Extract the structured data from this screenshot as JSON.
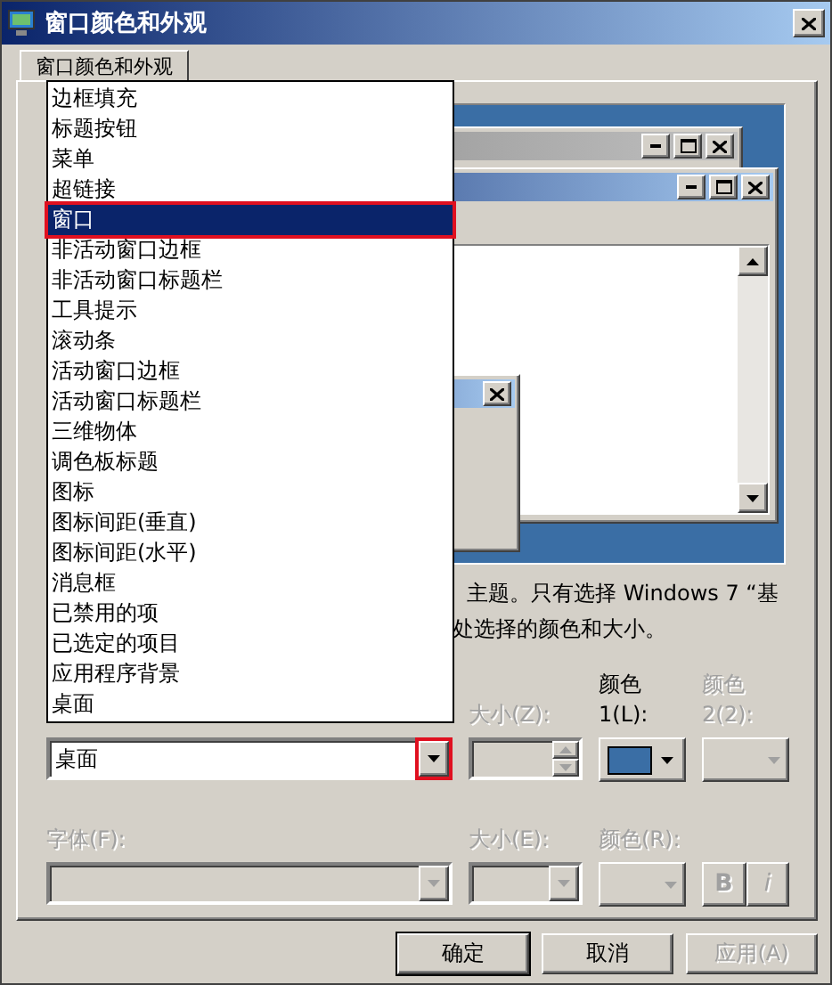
{
  "window": {
    "title": "窗口颜色和外观"
  },
  "tabs": [
    {
      "label": "窗口颜色和外观",
      "selected": true
    }
  ],
  "description": [
    "主题。只有选择 Windows 7 “基",
    "处选择的颜色和大小。"
  ],
  "item_list": {
    "options": [
      {
        "label": "边框填充",
        "selected": false,
        "highlighted": false
      },
      {
        "label": "标题按钮",
        "selected": false,
        "highlighted": false
      },
      {
        "label": "菜单",
        "selected": false,
        "highlighted": false
      },
      {
        "label": "超链接",
        "selected": false,
        "highlighted": false
      },
      {
        "label": "窗口",
        "selected": true,
        "highlighted": true
      },
      {
        "label": "非活动窗口边框",
        "selected": false,
        "highlighted": false
      },
      {
        "label": "非活动窗口标题栏",
        "selected": false,
        "highlighted": false
      },
      {
        "label": "工具提示",
        "selected": false,
        "highlighted": false
      },
      {
        "label": "滚动条",
        "selected": false,
        "highlighted": false
      },
      {
        "label": "活动窗口边框",
        "selected": false,
        "highlighted": false
      },
      {
        "label": "活动窗口标题栏",
        "selected": false,
        "highlighted": false
      },
      {
        "label": "三维物体",
        "selected": false,
        "highlighted": false
      },
      {
        "label": "调色板标题",
        "selected": false,
        "highlighted": false
      },
      {
        "label": "图标",
        "selected": false,
        "highlighted": false
      },
      {
        "label": "图标间距(垂直)",
        "selected": false,
        "highlighted": false
      },
      {
        "label": "图标间距(水平)",
        "selected": false,
        "highlighted": false
      },
      {
        "label": "消息框",
        "selected": false,
        "highlighted": false
      },
      {
        "label": "已禁用的项",
        "selected": false,
        "highlighted": false
      },
      {
        "label": "已选定的项目",
        "selected": false,
        "highlighted": false
      },
      {
        "label": "应用程序背景",
        "selected": false,
        "highlighted": false
      },
      {
        "label": "桌面",
        "selected": false,
        "highlighted": false
      }
    ]
  },
  "item_combo": {
    "value": "桌面",
    "button_highlighted": true
  },
  "size_field": {
    "label": "大小(Z):",
    "disabled": true
  },
  "color1": {
    "label": [
      "颜色",
      "1(L):"
    ],
    "disabled": false
  },
  "color2": {
    "label": [
      "颜色",
      "2(2):"
    ],
    "disabled": true
  },
  "font": {
    "label": "字体(F):",
    "disabled": true
  },
  "font_size": {
    "label": "大小(E):",
    "disabled": true
  },
  "font_color": {
    "label": "颜色(R):",
    "disabled": true
  },
  "style_buttons": [
    {
      "label": "B",
      "kind": "bold",
      "disabled": true
    },
    {
      "label": "i",
      "kind": "italic",
      "disabled": true
    }
  ],
  "buttons": [
    {
      "label": "确定",
      "disabled": false
    },
    {
      "label": "取消",
      "disabled": false
    },
    {
      "label": "应用(A)",
      "disabled": true
    }
  ]
}
